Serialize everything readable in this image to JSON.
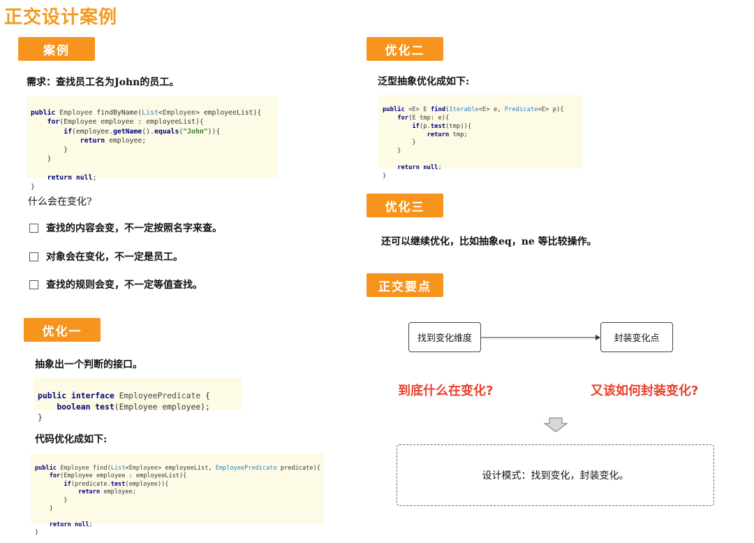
{
  "title": "正交设计案例",
  "sections": {
    "case": "案例",
    "opt1": "优化一",
    "opt2": "优化二",
    "opt3": "优化三",
    "key": "正交要点"
  },
  "requirement": "需求：查找员工名为John的员工。",
  "what_changes": "什么会在变化?",
  "checklist": [
    "查找的内容会变，不一定按照名字来查。",
    "对象会在变化，不一定是员工。",
    "查找的规则会变，不一定等值查找。"
  ],
  "opt1_desc": "抽象出一个判断的接口。",
  "opt1_code_desc": "代码优化成如下:",
  "opt2_desc": "泛型抽象优化成如下:",
  "opt3_desc": "还可以继续优化，比如抽象eq，ne 等比较操作。",
  "code": {
    "c1": [
      "public Employee findByName(List<Employee> employeeList){",
      "    for(Employee employee : employeeList){",
      "        if(employee.getName().equals(\"John\")){",
      "            return employee;",
      "        }",
      "    }",
      "",
      "    return null;",
      "}"
    ],
    "c2": [
      "public interface EmployeePredicate {",
      "    boolean test(Employee employee);",
      "}"
    ],
    "c3": [
      "public Employee find(List<Employee> employeeList, EmployeePredicate predicate){",
      "    for(Employee employee : employeeList){",
      "        if(predicate.test(employee)){",
      "            return employee;",
      "        }",
      "    }",
      "",
      "    return null;",
      "}"
    ],
    "c4": [
      "public <E> E find(Iterable<E> e, Predicate<E> p){",
      "    for(E tmp: e){",
      "        if(p.test(tmp)){",
      "            return tmp;",
      "        }",
      "    }",
      "",
      "    return null;",
      "}"
    ]
  },
  "diagram": {
    "node_left": "找到变化维度",
    "node_right": "封装变化点",
    "question_left": "到底什么在变化?",
    "question_right": "又该如何封装变化?",
    "conclusion": "设计模式：找到变化，封装变化。"
  }
}
